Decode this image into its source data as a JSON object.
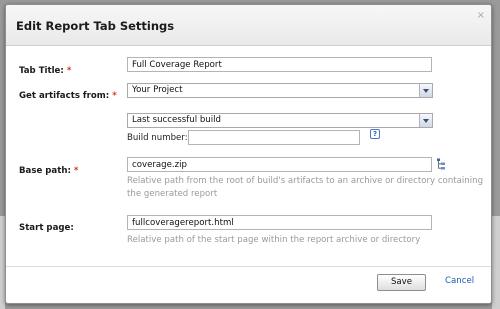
{
  "dialog": {
    "title": "Edit Report Tab Settings",
    "close_glyph": "×"
  },
  "form": {
    "tab_title": {
      "label": "Tab Title:",
      "required_mark": "*",
      "value": "Full Coverage Report"
    },
    "get_artifacts": {
      "label": "Get artifacts from:",
      "required_mark": "*",
      "selected": "Your Project"
    },
    "build": {
      "selected": "Last successful build",
      "build_number_label": "Build number:",
      "build_number_value": "",
      "help_glyph": "?"
    },
    "base_path": {
      "label": "Base path:",
      "required_mark": "*",
      "value": "coverage.zip",
      "hint_line1": "Relative path from the root of build's artifacts to an archive or directory containing",
      "hint_line2": "the generated report"
    },
    "start_page": {
      "label": "Start page:",
      "value": "fullcoveragereport.html",
      "hint": "Relative path of the start page within the report archive or directory"
    }
  },
  "footer": {
    "save_label": "Save",
    "cancel_label": "Cancel"
  },
  "colors": {
    "required": "#e0301e",
    "link": "#1a5ab8",
    "hint": "#9a9a9a"
  }
}
